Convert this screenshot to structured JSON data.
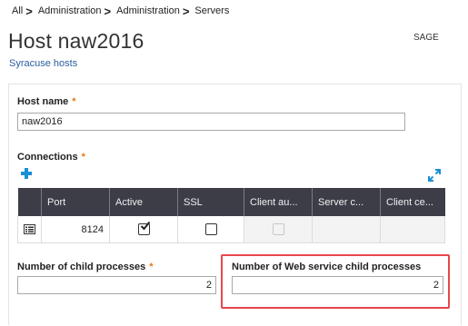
{
  "breadcrumb": [
    {
      "label": "All"
    },
    {
      "label": "Administration"
    },
    {
      "label": "Administration"
    },
    {
      "label": "Servers"
    }
  ],
  "breadcrumb_separator": ">",
  "page": {
    "title": "Host naw2016",
    "subtitle": "Syracuse hosts",
    "app_tag": "SAGE"
  },
  "host_name": {
    "label": "Host name",
    "required_mark": "*",
    "value": "naw2016"
  },
  "connections": {
    "label": "Connections",
    "required_mark": "*",
    "add_icon": "plus-icon",
    "expand_icon": "expand-diagonal-icon",
    "columns": [
      "",
      "Port",
      "Active",
      "SSL",
      "Client au...",
      "Server c...",
      "Client ce..."
    ],
    "rows": [
      {
        "row_icon": "row-detail-icon",
        "port": "8124",
        "active": true,
        "ssl": false,
        "client_auth": false,
        "client_auth_disabled": true
      }
    ]
  },
  "child_processes": {
    "label": "Number of child processes",
    "required_mark": "*",
    "value": "2"
  },
  "web_service_child_processes": {
    "label": "Number of Web service child processes",
    "value": "2"
  },
  "colors": {
    "accent_blue": "#1a8fd6",
    "link_blue": "#2a5e9e",
    "required_orange": "#e7781b",
    "grid_header": "#3d3d48",
    "highlight_red": "#e8474b"
  }
}
